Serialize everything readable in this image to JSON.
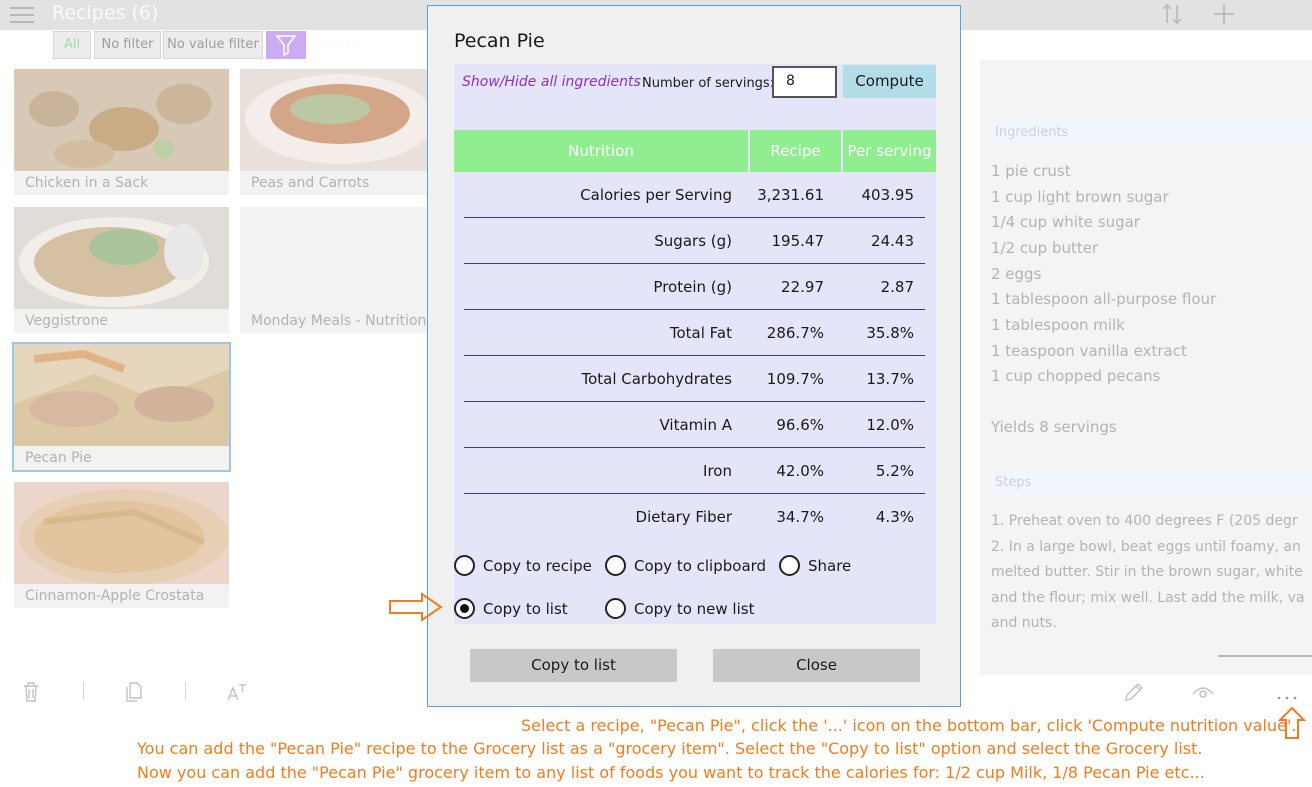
{
  "app": {
    "title": "Recipes (6)",
    "count": "6 of 6"
  },
  "filters": {
    "all": "All",
    "no_filter": "No filter",
    "no_value_filter": "No value filter"
  },
  "recipes": [
    {
      "name": "Chicken in a Sack"
    },
    {
      "name": "Peas and Carrots"
    },
    {
      "name": "Veggistrone"
    },
    {
      "name": "Monday Meals - Nutrition"
    },
    {
      "name": "Pecan Pie"
    },
    {
      "name": "Cinnamon-Apple Crostata"
    }
  ],
  "details": {
    "ingredients_header": "Ingredients",
    "ingredients": [
      "1 pie crust",
      "1 cup light brown sugar",
      "1/4 cup white sugar",
      "1/2 cup butter",
      "2 eggs",
      "1 tablespoon all-purpose flour",
      "1 tablespoon milk",
      "1 teaspoon vanilla extract",
      "1 cup chopped pecans"
    ],
    "yields": "Yields 8 servings",
    "steps_header": "Steps",
    "steps": [
      "1. Preheat oven to 400 degrees F (205 degr",
      "2. In a large bowl, beat eggs until foamy, an",
      "melted butter. Stir in the brown sugar, white",
      "and the flour; mix well. Last add the milk, va",
      "and nuts."
    ]
  },
  "dialog": {
    "title": "Pecan Pie",
    "show_hide": "Show/Hide all ingredients",
    "servings_label": "Number of servings:",
    "servings_value": "8",
    "compute": "Compute",
    "headers": {
      "nutrition": "Nutrition",
      "recipe": "Recipe",
      "per_serving": "Per serving"
    },
    "rows": [
      {
        "name": "Calories per Serving",
        "recipe": "3,231.61",
        "per": "403.95"
      },
      {
        "name": "Sugars (g)",
        "recipe": "195.47",
        "per": "24.43"
      },
      {
        "name": "Protein (g)",
        "recipe": "22.97",
        "per": "2.87"
      },
      {
        "name": "Total Fat",
        "recipe": "286.7%",
        "per": "35.8%"
      },
      {
        "name": "Total Carbohydrates",
        "recipe": "109.7%",
        "per": "13.7%"
      },
      {
        "name": "Vitamin A",
        "recipe": "96.6%",
        "per": "12.0%"
      },
      {
        "name": "Iron",
        "recipe": "42.0%",
        "per": "5.2%"
      },
      {
        "name": "Dietary Fiber",
        "recipe": "34.7%",
        "per": "4.3%"
      }
    ],
    "options": {
      "copy_to_recipe": "Copy to recipe",
      "copy_to_clipboard": "Copy to clipboard",
      "share": "Share",
      "copy_to_list": "Copy to list",
      "copy_to_new_list": "Copy to new list"
    },
    "selected_option": "copy_to_list",
    "buttons": {
      "copy_to_list": "Copy to list",
      "close": "Close"
    }
  },
  "instructions": [
    "Select a recipe, \"Pecan Pie\", click the '...' icon on the bottom bar, click 'Compute nutrition value'.",
    "You can add the \"Pecan Pie\" recipe to the Grocery list as a \"grocery item\". Select the \"Copy to list\" option and select the Grocery list.",
    "Now you can add the \"Pecan Pie\" grocery item to any list of foods you want to track the calories for: 1/2 cup Milk, 1/8 Pecan Pie etc..."
  ],
  "colors": {
    "accent_purple": "#8c2fc8",
    "header_green": "#90ee90",
    "compute_blue": "#b2dde8",
    "annotation_orange": "#f17c1e",
    "dialog_border": "#5aa1e0"
  }
}
